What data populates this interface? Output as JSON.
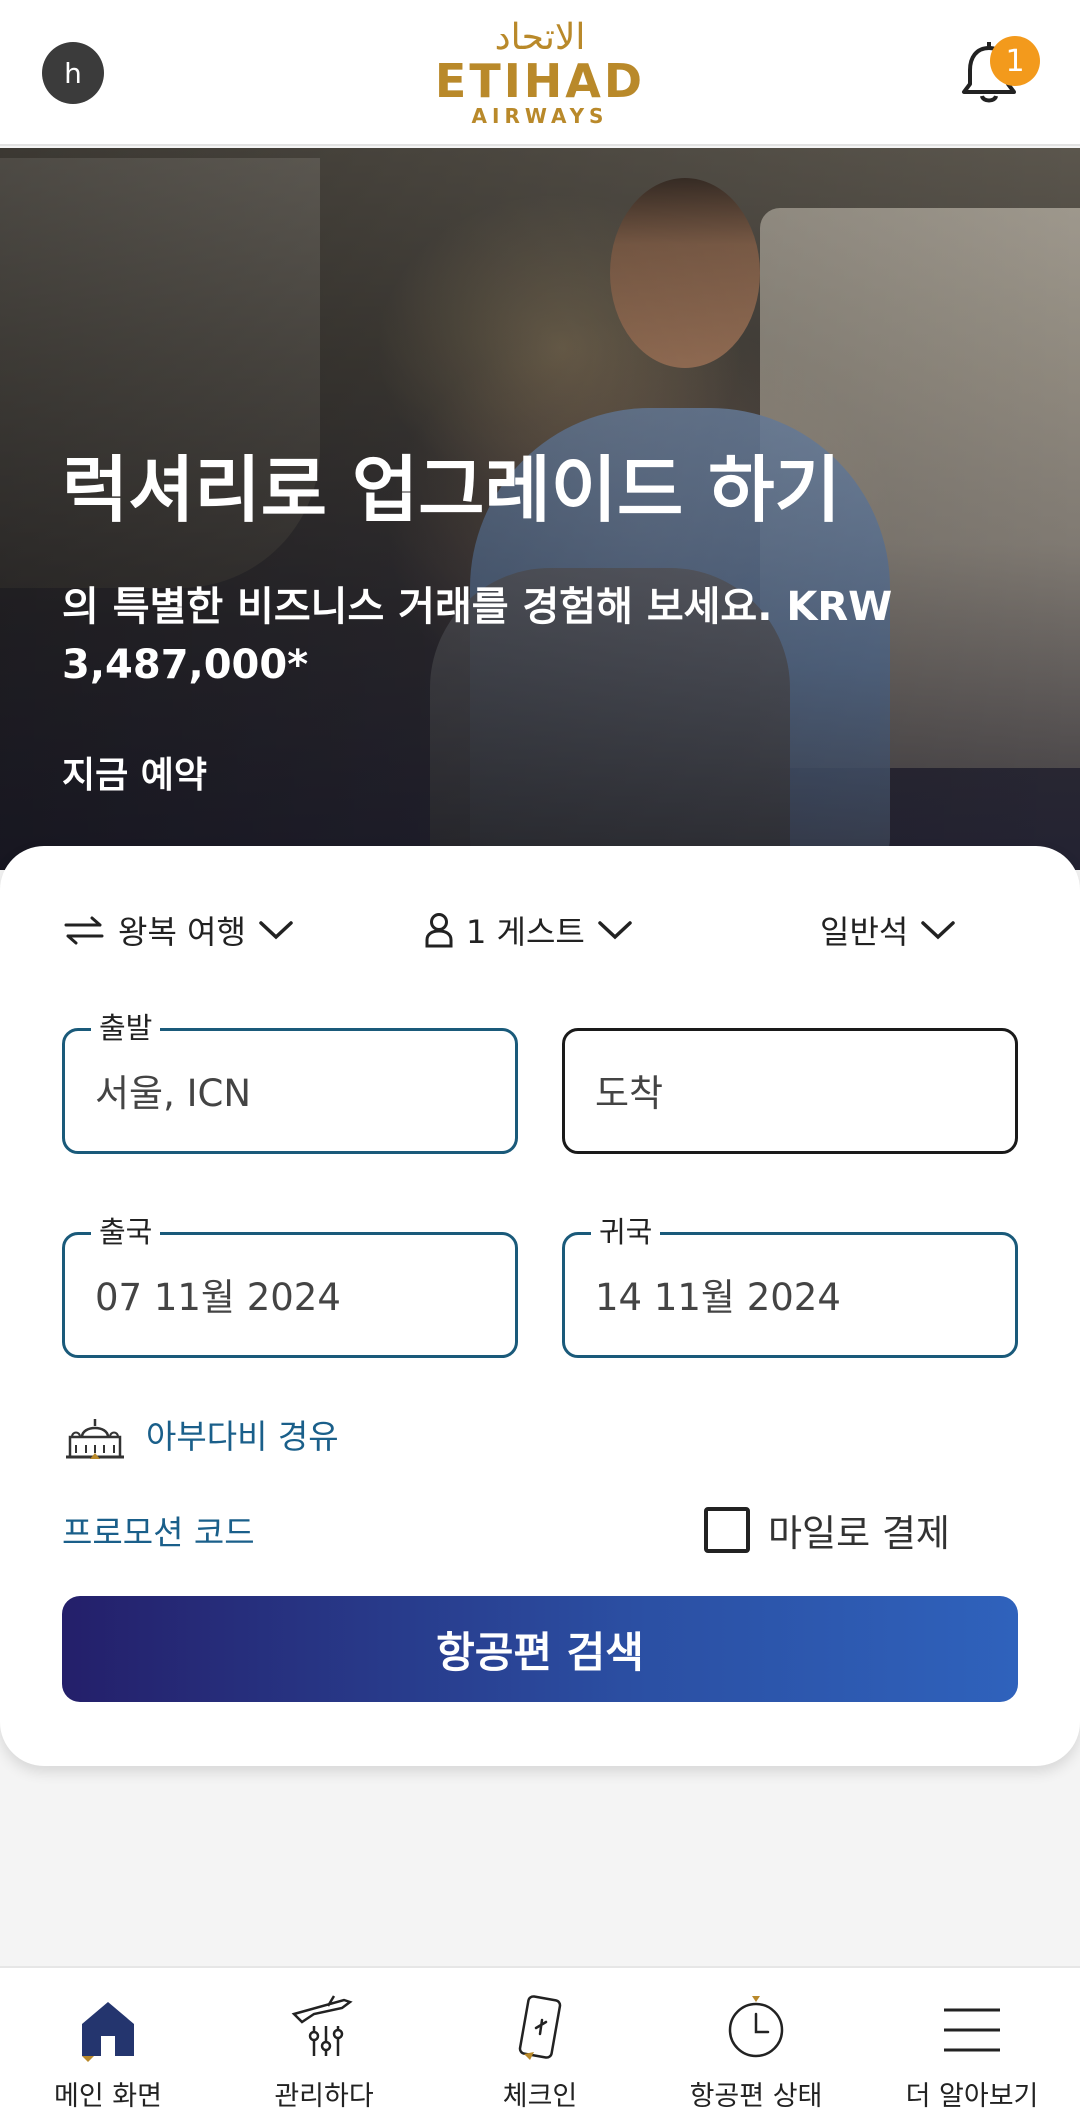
{
  "header": {
    "avatar_initial": "h",
    "logo_arabic": "الاتحاد",
    "logo_word": "ETIHAD",
    "logo_sub": "AIRWAYS",
    "notification_count": "1"
  },
  "hero": {
    "title": "럭셔리로 업그레이드 하기",
    "subtitle": "의 특별한 비즈니스 거래를 경험해 보세요. KRW 3,487,000*",
    "cta": "지금 예약",
    "slide_count": 5,
    "active_slide": 1
  },
  "booking": {
    "trip_type": "왕복 여행",
    "guests": "1 게스트",
    "cabin": "일반석",
    "origin": {
      "label": "출발",
      "value": "서울, ICN"
    },
    "destination": {
      "placeholder": "도착"
    },
    "depart": {
      "label": "출국",
      "value": "07 11월 2024"
    },
    "return": {
      "label": "귀국",
      "value": "14 11월 2024"
    },
    "via_label": "아부다비 경유",
    "promo_label": "프로모션 코드",
    "miles_label": "마일로 결제",
    "miles_checked": false,
    "search_button": "항공편 검색"
  },
  "nav": {
    "items": [
      {
        "label": "메인 화면",
        "icon": "home-icon"
      },
      {
        "label": "관리하다",
        "icon": "manage-flight-icon"
      },
      {
        "label": "체크인",
        "icon": "boarding-pass-icon"
      },
      {
        "label": "항공편 상태",
        "icon": "clock-icon"
      },
      {
        "label": "더 알아보기",
        "icon": "menu-icon"
      }
    ]
  },
  "colors": {
    "brand_gold": "#b9892a",
    "accent_blue": "#1a5f8a",
    "badge_orange": "#f39a1c",
    "button_start": "#241f6a",
    "button_end": "#2f62bc"
  }
}
